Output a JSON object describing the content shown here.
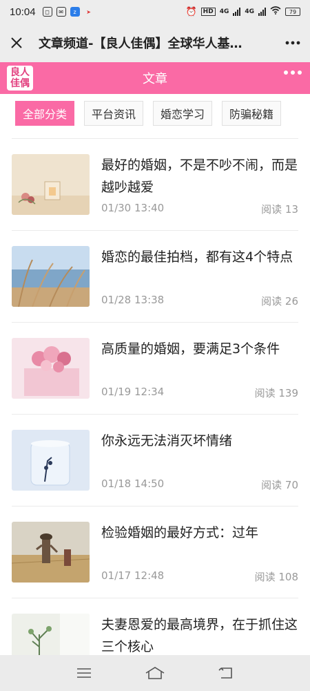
{
  "status": {
    "time": "10:04",
    "network1": "HD",
    "network2": "4G",
    "network3": "4G",
    "battery": "79"
  },
  "nav": {
    "title": "文章频道-【良人佳偶】全球华人基…"
  },
  "header": {
    "logo_line1": "良人",
    "logo_line2": "佳偶",
    "title": "文章",
    "accent_color": "#fa6aa5"
  },
  "tabs": [
    {
      "label": "全部分类",
      "active": true
    },
    {
      "label": "平台资讯",
      "active": false
    },
    {
      "label": "婚恋学习",
      "active": false
    },
    {
      "label": "防骗秘籍",
      "active": false
    }
  ],
  "articles": [
    {
      "title": "最好的婚姻，不是不吵不闹，而是越吵越爱",
      "date": "01/30 13:40",
      "reads": "阅读 13",
      "thumb": "cozy-room-flowers"
    },
    {
      "title": "婚恋的最佳拍档，都有这4个特点",
      "date": "01/28 13:38",
      "reads": "阅读 26",
      "thumb": "reeds-by-lake"
    },
    {
      "title": "高质量的婚姻，要满足3个条件",
      "date": "01/19 12:34",
      "reads": "阅读 139",
      "thumb": "pink-flowers-box"
    },
    {
      "title": "你永远无法消灭坏情绪",
      "date": "01/18 14:50",
      "reads": "阅读 70",
      "thumb": "ice-candle"
    },
    {
      "title": "检验婚姻的最好方式：过年",
      "date": "01/17 12:48",
      "reads": "阅读 108",
      "thumb": "woman-in-field"
    },
    {
      "title": "夫妻恩爱的最高境界，在于抓住这三个核心",
      "date": "",
      "reads": "",
      "thumb": "plant-by-window"
    }
  ]
}
